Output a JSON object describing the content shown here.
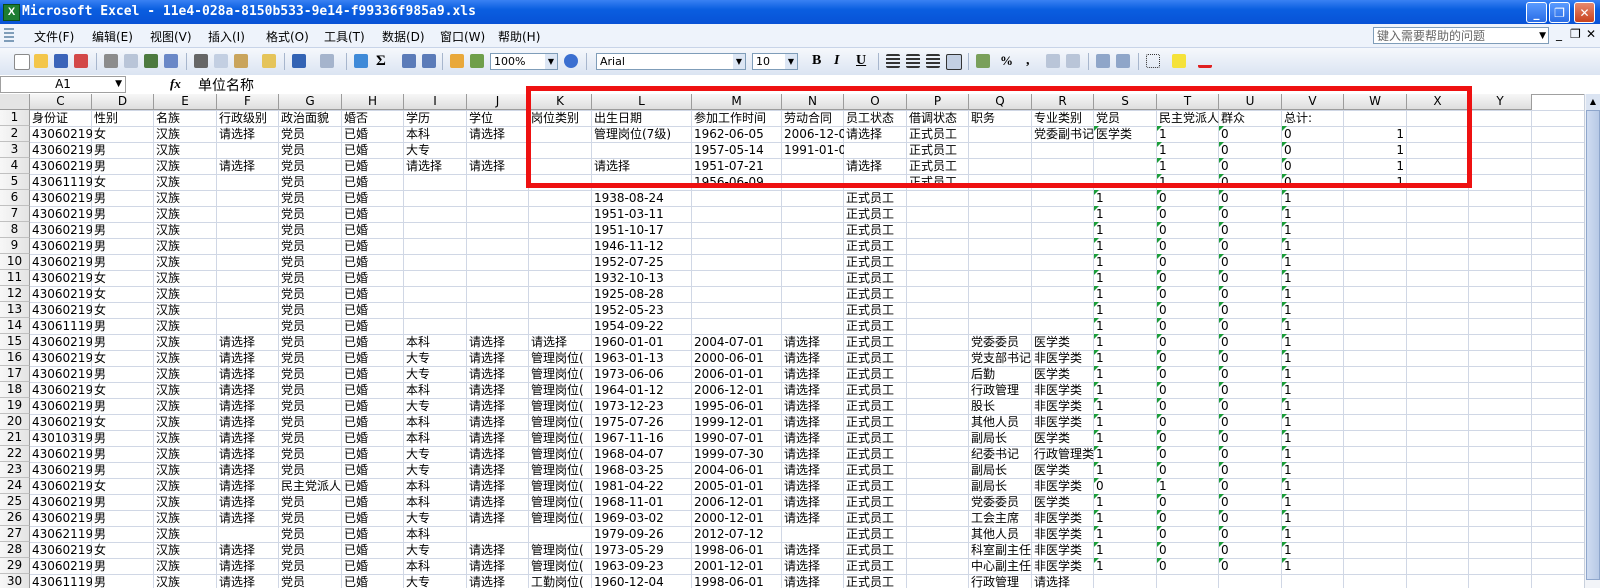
{
  "window": {
    "title": "Microsoft Excel - 11e4-028a-8150b533-9e14-f99336f985a9.xls",
    "app_icon": "X",
    "minimize": "_",
    "restore": "❐",
    "close": "✕"
  },
  "menu": {
    "items": [
      "文件(F)",
      "编辑(E)",
      "视图(V)",
      "插入(I)",
      "格式(O)",
      "工具(T)",
      "数据(D)",
      "窗口(W)",
      "帮助(H)"
    ],
    "help_placeholder": "键入需要帮助的问题",
    "mdi_minimize": "_",
    "mdi_restore": "❐",
    "mdi_close": "✕"
  },
  "toolbar": {
    "zoom": "100%",
    "font": "Arial",
    "font_size": "10",
    "bold": "B",
    "italic": "I",
    "underline": "U",
    "sigma": "Σ",
    "percent": "%",
    "comma": ",",
    "icons": [
      "new-icon",
      "open-icon",
      "save-icon",
      "permission-icon",
      "print-icon",
      "print-preview-icon",
      "spelling-icon",
      "research-icon",
      "cut-icon",
      "copy-icon",
      "paste-icon",
      "format-painter-icon",
      "undo-icon",
      "redo-icon",
      "hyperlink-icon",
      "autosum-icon",
      "sort-ascending-icon",
      "sort-descending-icon",
      "chart-wizard-icon",
      "drawing-icon",
      "help-icon",
      "align-left-icon",
      "align-center-icon",
      "align-right-icon",
      "merge-center-icon",
      "currency-icon",
      "increase-decimal-icon",
      "decrease-decimal-icon",
      "decrease-indent-icon",
      "increase-indent-icon",
      "borders-icon",
      "fill-color-icon",
      "font-color-icon"
    ]
  },
  "formula_bar": {
    "name_box": "A1",
    "fx": "fx",
    "content": "单位名称"
  },
  "sheet": {
    "columns": [
      "C",
      "D",
      "E",
      "F",
      "G",
      "H",
      "I",
      "J",
      "K",
      "L",
      "M",
      "N",
      "O",
      "P",
      "Q",
      "R",
      "S",
      "T",
      "U",
      "V",
      "W",
      "X",
      "Y"
    ],
    "rows": [
      [
        "身份证",
        "性别",
        "名族",
        "行政级别",
        "政治面貌",
        "婚否",
        "学历",
        "学位",
        "岗位类别",
        "出生日期",
        "参加工作时间",
        "劳动合同",
        "员工状态",
        "借调状态",
        "职务",
        "专业类别",
        "党员",
        "民主党派人",
        "群众",
        "总计:",
        "",
        "",
        ""
      ],
      [
        "430602196",
        "女",
        "汉族",
        "请选择",
        "党员",
        "已婚",
        "本科",
        "请选择",
        "",
        "管理岗位(7级)",
        "1962-06-05",
        "2006-12-0",
        "请选择",
        "正式员工",
        "",
        "党委副书记",
        "医学类",
        "1",
        "0",
        "0",
        "1",
        "",
        ""
      ],
      [
        "430602195",
        "男",
        "汉族",
        "",
        "党员",
        "已婚",
        "大专",
        "",
        "",
        "",
        "1957-05-14",
        "1991-01-0",
        "",
        "正式员工",
        "",
        "",
        "",
        "1",
        "0",
        "0",
        "1",
        "",
        ""
      ],
      [
        "430602195",
        "男",
        "汉族",
        "请选择",
        "党员",
        "已婚",
        "请选择",
        "请选择",
        "",
        "请选择",
        "1951-07-21",
        "",
        "请选择",
        "正式员工",
        "",
        "",
        "",
        "1",
        "0",
        "0",
        "1",
        "",
        ""
      ],
      [
        "430611195",
        "女",
        "汉族",
        "",
        "党员",
        "已婚",
        "",
        "",
        "",
        "",
        "1956-06-09",
        "",
        "",
        "正式员工",
        "",
        "",
        "",
        "1",
        "0",
        "0",
        "1",
        "",
        ""
      ],
      [
        "430602193",
        "男",
        "汉族",
        "",
        "党员",
        "已婚",
        "",
        "",
        "",
        "1938-08-24",
        "",
        "",
        "正式员工",
        "",
        "",
        "",
        "1",
        "0",
        "0",
        "1",
        "",
        "",
        ""
      ],
      [
        "430602195",
        "男",
        "汉族",
        "",
        "党员",
        "已婚",
        "",
        "",
        "",
        "1951-03-11",
        "",
        "",
        "正式员工",
        "",
        "",
        "",
        "1",
        "0",
        "0",
        "1",
        "",
        "",
        ""
      ],
      [
        "430602195",
        "男",
        "汉族",
        "",
        "党员",
        "已婚",
        "",
        "",
        "",
        "1951-10-17",
        "",
        "",
        "正式员工",
        "",
        "",
        "",
        "1",
        "0",
        "0",
        "1",
        "",
        "",
        ""
      ],
      [
        "430602194",
        "男",
        "汉族",
        "",
        "党员",
        "已婚",
        "",
        "",
        "",
        "1946-11-12",
        "",
        "",
        "正式员工",
        "",
        "",
        "",
        "1",
        "0",
        "0",
        "1",
        "",
        "",
        ""
      ],
      [
        "430602195",
        "男",
        "汉族",
        "",
        "党员",
        "已婚",
        "",
        "",
        "",
        "1952-07-25",
        "",
        "",
        "正式员工",
        "",
        "",
        "",
        "1",
        "0",
        "0",
        "1",
        "",
        "",
        ""
      ],
      [
        "430602193",
        "女",
        "汉族",
        "",
        "党员",
        "已婚",
        "",
        "",
        "",
        "1932-10-13",
        "",
        "",
        "正式员工",
        "",
        "",
        "",
        "1",
        "0",
        "0",
        "1",
        "",
        "",
        ""
      ],
      [
        "430602192",
        "女",
        "汉族",
        "",
        "党员",
        "已婚",
        "",
        "",
        "",
        "1925-08-28",
        "",
        "",
        "正式员工",
        "",
        "",
        "",
        "1",
        "0",
        "0",
        "1",
        "",
        "",
        ""
      ],
      [
        "430602195",
        "女",
        "汉族",
        "",
        "党员",
        "已婚",
        "",
        "",
        "",
        "1952-05-23",
        "",
        "",
        "正式员工",
        "",
        "",
        "",
        "1",
        "0",
        "0",
        "1",
        "",
        "",
        ""
      ],
      [
        "430611195",
        "男",
        "汉族",
        "",
        "党员",
        "已婚",
        "",
        "",
        "",
        "1954-09-22",
        "",
        "",
        "正式员工",
        "",
        "",
        "",
        "1",
        "0",
        "0",
        "1",
        "",
        "",
        ""
      ],
      [
        "430602196",
        "男",
        "汉族",
        "请选择",
        "党员",
        "已婚",
        "本科",
        "请选择",
        "请选择",
        "1960-01-01",
        "2004-07-01",
        "请选择",
        "正式员工",
        "",
        "党委委员",
        "医学类",
        "1",
        "0",
        "0",
        "1",
        "",
        "",
        ""
      ],
      [
        "430602196",
        "女",
        "汉族",
        "请选择",
        "党员",
        "已婚",
        "大专",
        "请选择",
        "管理岗位(",
        "1963-01-13",
        "2000-06-01",
        "请选择",
        "正式员工",
        "",
        "党支部书记",
        "非医学类",
        "1",
        "0",
        "0",
        "1",
        "",
        "",
        ""
      ],
      [
        "430602197",
        "男",
        "汉族",
        "请选择",
        "党员",
        "已婚",
        "大专",
        "请选择",
        "管理岗位(",
        "1973-06-06",
        "2006-01-01",
        "请选择",
        "正式员工",
        "",
        "后勤",
        "医学类",
        "1",
        "0",
        "0",
        "1",
        "",
        "",
        ""
      ],
      [
        "430602196",
        "女",
        "汉族",
        "请选择",
        "党员",
        "已婚",
        "本科",
        "请选择",
        "管理岗位(",
        "1964-01-12",
        "2006-12-01",
        "请选择",
        "正式员工",
        "",
        "行政管理",
        "非医学类",
        "1",
        "0",
        "0",
        "1",
        "",
        "",
        ""
      ],
      [
        "430602197",
        "男",
        "汉族",
        "请选择",
        "党员",
        "已婚",
        "大专",
        "请选择",
        "管理岗位(",
        "1973-12-23",
        "1995-06-01",
        "请选择",
        "正式员工",
        "",
        "股长",
        "非医学类",
        "1",
        "0",
        "0",
        "1",
        "",
        "",
        ""
      ],
      [
        "430602197",
        "女",
        "汉族",
        "请选择",
        "党员",
        "已婚",
        "本科",
        "请选择",
        "管理岗位(",
        "1975-07-26",
        "1999-12-01",
        "请选择",
        "正式员工",
        "",
        "其他人员",
        "非医学类",
        "1",
        "0",
        "0",
        "1",
        "",
        "",
        ""
      ],
      [
        "430103196",
        "男",
        "汉族",
        "请选择",
        "党员",
        "已婚",
        "本科",
        "请选择",
        "管理岗位(",
        "1967-11-16",
        "1990-07-01",
        "请选择",
        "正式员工",
        "",
        "副局长",
        "医学类",
        "1",
        "0",
        "0",
        "1",
        "",
        "",
        ""
      ],
      [
        "430602196",
        "男",
        "汉族",
        "请选择",
        "党员",
        "已婚",
        "大专",
        "请选择",
        "管理岗位(",
        "1968-04-07",
        "1999-07-30",
        "请选择",
        "正式员工",
        "",
        "纪委书记",
        "行政管理类",
        "1",
        "0",
        "0",
        "1",
        "",
        "",
        ""
      ],
      [
        "430602196",
        "男",
        "汉族",
        "请选择",
        "党员",
        "已婚",
        "大专",
        "请选择",
        "管理岗位(",
        "1968-03-25",
        "2004-06-01",
        "请选择",
        "正式员工",
        "",
        "副局长",
        "医学类",
        "1",
        "0",
        "0",
        "1",
        "",
        "",
        ""
      ],
      [
        "430602198",
        "女",
        "汉族",
        "请选择",
        "民主党派人",
        "已婚",
        "本科",
        "请选择",
        "管理岗位(",
        "1981-04-22",
        "2005-01-01",
        "请选择",
        "正式员工",
        "",
        "副局长",
        "非医学类",
        "0",
        "1",
        "0",
        "1",
        "",
        "",
        ""
      ],
      [
        "430602196",
        "男",
        "汉族",
        "请选择",
        "党员",
        "已婚",
        "本科",
        "请选择",
        "管理岗位(",
        "1968-11-01",
        "2006-12-01",
        "请选择",
        "正式员工",
        "",
        "党委委员",
        "医学类",
        "1",
        "0",
        "0",
        "1",
        "",
        "",
        ""
      ],
      [
        "430602196",
        "男",
        "汉族",
        "请选择",
        "党员",
        "已婚",
        "大专",
        "请选择",
        "管理岗位(",
        "1969-03-02",
        "2000-12-01",
        "请选择",
        "正式员工",
        "",
        "工会主席",
        "非医学类",
        "1",
        "0",
        "0",
        "1",
        "",
        "",
        ""
      ],
      [
        "430621197",
        "男",
        "汉族",
        "",
        "党员",
        "已婚",
        "本科",
        "",
        "",
        "1979-09-26",
        "2012-07-12",
        "",
        "正式员工",
        "",
        "其他人员",
        "非医学类",
        "1",
        "0",
        "0",
        "1",
        "",
        "",
        ""
      ],
      [
        "430602197",
        "女",
        "汉族",
        "请选择",
        "党员",
        "已婚",
        "大专",
        "请选择",
        "管理岗位(",
        "1973-05-29",
        "1998-06-01",
        "请选择",
        "正式员工",
        "",
        "科室副主任",
        "非医学类",
        "1",
        "0",
        "0",
        "1",
        "",
        "",
        ""
      ],
      [
        "430602196",
        "男",
        "汉族",
        "请选择",
        "党员",
        "已婚",
        "本科",
        "请选择",
        "管理岗位(",
        "1963-09-23",
        "2001-12-01",
        "请选择",
        "正式员工",
        "",
        "中心副主任",
        "非医学类",
        "1",
        "0",
        "0",
        "1",
        "",
        "",
        ""
      ],
      [
        "430611196",
        "男",
        "汉族",
        "请选择",
        "党员",
        "已婚",
        "大专",
        "请选择",
        "工勤岗位(",
        "1960-12-04",
        "1998-06-01",
        "请选择",
        "正式员工",
        "",
        "行政管理",
        "请选择",
        "",
        "",
        "",
        "",
        "",
        "",
        ""
      ]
    ],
    "row_numbers": [
      "1",
      "2",
      "3",
      "4",
      "5",
      "6",
      "7",
      "8",
      "9",
      "10",
      "11",
      "12",
      "13",
      "14",
      "15",
      "16",
      "17",
      "18",
      "19",
      "20",
      "21",
      "22",
      "23",
      "24",
      "25",
      "26",
      "27",
      "28",
      "29",
      "30"
    ]
  },
  "colors": {
    "titlebar": "#0a5ee0",
    "highlight": "#ee1111",
    "error_triangle": "#1b9d3a"
  }
}
